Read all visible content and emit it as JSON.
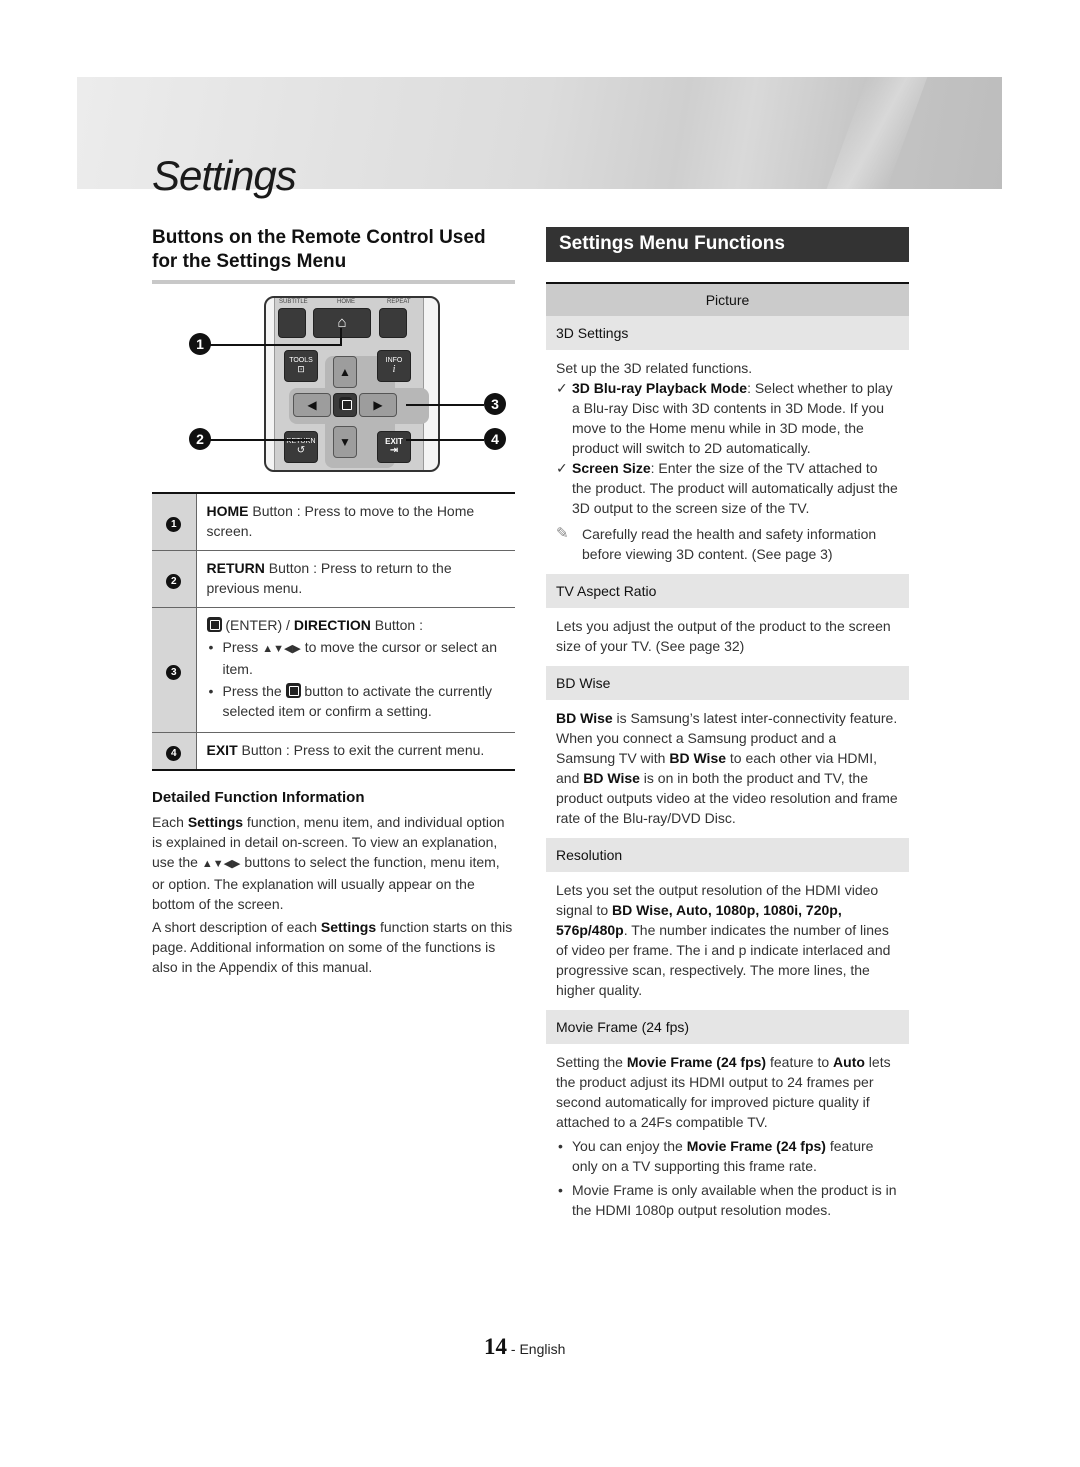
{
  "page": {
    "title": "Settings",
    "page_number": "14",
    "language": " - English"
  },
  "left": {
    "heading": "Buttons on the Remote Control Used for the Settings Menu",
    "remote": {
      "labels": {
        "subtitle": "SUBTITLE",
        "home": "HOME",
        "repeat": "REPEAT",
        "tools": "TOOLS",
        "info": "INFO",
        "return": "RETURN",
        "exit": "EXIT"
      },
      "glyphs": {
        "home": "⌂",
        "info": "i",
        "tools": "⊡",
        "return": "↺",
        "exit": "⇥",
        "up": "▲",
        "down": "▼",
        "left": "◀",
        "right": "▶"
      },
      "callouts": [
        "1",
        "2",
        "3",
        "4"
      ]
    },
    "button_table": [
      {
        "num": "1",
        "name": "HOME",
        "text": " Button : Press to move to the Home screen."
      },
      {
        "num": "2",
        "name": "RETURN",
        "text": " Button : Press to return to the previous menu."
      },
      {
        "num": "3",
        "name_pre": " (ENTER) / ",
        "name": "DIRECTION",
        "text": " Button :",
        "bullets": [
          {
            "pre": "Press ",
            "arrows": "▲▼◀▶",
            "post": " to move the cursor or select an item."
          },
          {
            "pre": "Press the ",
            "post": " button to activate the currently selected item or confirm a setting."
          }
        ]
      },
      {
        "num": "4",
        "name": "EXIT",
        "text": " Button : Press to exit the current menu."
      }
    ],
    "detail_heading": "Detailed Function Information",
    "para1": {
      "a": "Each ",
      "b": "Settings",
      "c": " function, menu item, and individual option is explained in detail on-screen. To view an explanation, use the ",
      "arrows": "▲▼◀▶",
      "d": " buttons to select the function, menu item, or option. The explanation will usually appear on the bottom of the screen."
    },
    "para2": {
      "a": "A short description of each ",
      "b": "Settings",
      "c": " function starts on this page. Additional information on some of the functions is also in the Appendix of this manual."
    }
  },
  "right": {
    "heading": "Settings Menu Functions",
    "category": "Picture",
    "items": {
      "3d": {
        "title": "3D Settings",
        "intro": "Set up the 3D related functions.",
        "checks": [
          {
            "bold": "3D Blu-ray Playback Mode",
            "text": ": Select whether to play a Blu-ray Disc with 3D contents in 3D Mode. If you move to the Home menu while in 3D mode, the product will switch to 2D automatically."
          },
          {
            "bold": "Screen Size",
            "text": ": Enter the size of the TV attached to the product. The product will automatically adjust the 3D output to the screen size of the TV."
          }
        ],
        "note": "Carefully read the health and safety information before viewing 3D content. (See page 3)"
      },
      "aspect": {
        "title": "TV Aspect Ratio",
        "text": "Lets you adjust the output of the product to the screen size of your TV. (See page 32)"
      },
      "bdwise": {
        "title": "BD Wise",
        "b1": "BD Wise",
        "t1": " is Samsung’s latest inter-connectivity feature. When you connect a Samsung product and a Samsung TV with ",
        "b2": "BD Wise",
        "t2": " to each other via HDMI, and ",
        "b3": "BD Wise",
        "t3": " is on in both the product and TV, the product outputs video at the video resolution and frame rate of the Blu-ray/DVD Disc."
      },
      "resolution": {
        "title": "Resolution",
        "t1": "Lets you set the output resolution of the HDMI video signal to ",
        "b1": "BD Wise, Auto, 1080p, 1080i, 720p, 576p/480p",
        "t2": ". The number indicates the number of lines of video per frame. The i and p indicate interlaced and progressive scan, respectively. The more lines, the higher quality."
      },
      "movie": {
        "title": "Movie Frame (24 fps)",
        "t1": "Setting the ",
        "b1": "Movie Frame (24 fps)",
        "t2": " feature to ",
        "b2": "Auto",
        "t3": " lets the product adjust its HDMI output to 24 frames per second automatically for improved picture quality if attached to a 24Fs compatible TV.",
        "bullets": [
          {
            "pre": "You can enjoy the ",
            "bold": "Movie Frame (24 fps)",
            "post": " feature only on a TV supporting this frame rate."
          },
          {
            "pre": "Movie Frame is only available when the product is in the HDMI 1080p output resolution modes.",
            "bold": "",
            "post": ""
          }
        ]
      }
    }
  }
}
